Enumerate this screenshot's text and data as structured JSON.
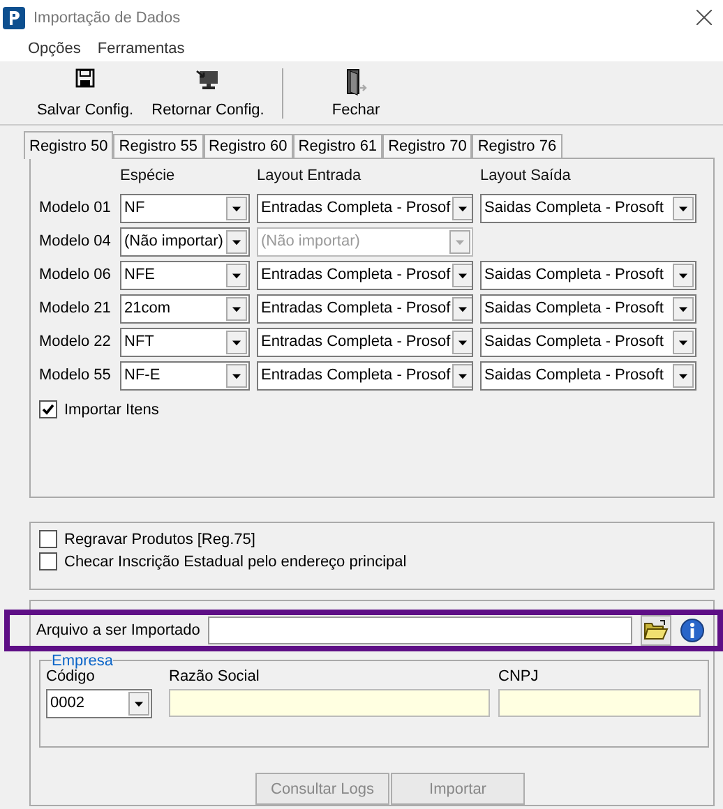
{
  "window": {
    "title": "Importação de Dados"
  },
  "menu": [
    "Opções",
    "Ferramentas"
  ],
  "toolbar": [
    {
      "label": "Salvar Config.",
      "kind": "save"
    },
    {
      "label": "Retornar Config.",
      "kind": "restore"
    },
    {
      "label": "Fechar",
      "kind": "exit"
    }
  ],
  "tabs": [
    {
      "label": "Registro 50",
      "selected": true
    },
    {
      "label": "Registro 55",
      "selected": false
    },
    {
      "label": "Registro 60",
      "selected": false
    },
    {
      "label": "Registro 61",
      "selected": false
    },
    {
      "label": "Registro 70",
      "selected": false
    },
    {
      "label": "Registro 76",
      "selected": false
    }
  ],
  "grid": {
    "headers": [
      "Espécie",
      "Layout Entrada",
      "Layout Saída"
    ],
    "rows": [
      {
        "label": "Modelo 01",
        "especie": "NF",
        "entrada": {
          "value": "Entradas Completa - Prosof",
          "disabled": false
        },
        "saida": "Saidas Completa - Prosoft"
      },
      {
        "label": "Modelo 04",
        "especie": "(Não importar)",
        "entrada": {
          "value": "(Não importar)",
          "disabled": true
        }
      },
      {
        "label": "Modelo 06",
        "especie": "NFE",
        "entrada": {
          "value": "Entradas Completa - Prosof",
          "disabled": false
        },
        "saida": "Saidas Completa - Prosoft"
      },
      {
        "label": "Modelo 21",
        "especie": "21com",
        "entrada": {
          "value": "Entradas Completa - Prosof",
          "disabled": false
        },
        "saida": "Saidas Completa - Prosoft"
      },
      {
        "label": "Modelo 22",
        "especie": "NFT",
        "entrada": {
          "value": "Entradas Completa - Prosof",
          "disabled": false
        },
        "saida": "Saidas Completa - Prosoft"
      },
      {
        "label": "Modelo 55",
        "especie": "NF-E",
        "entrada": {
          "value": "Entradas Completa - Prosof",
          "disabled": false
        },
        "saida": "Saidas Completa - Prosoft"
      }
    ]
  },
  "import_items": {
    "label": "Importar Itens",
    "checked": true
  },
  "options": [
    {
      "label": "Regravar Produtos [Reg.75]",
      "checked": false
    },
    {
      "label": "Checar Inscrição Estadual pelo endereço principal",
      "checked": false
    }
  ],
  "file": {
    "label": "Arquivo a ser Importado",
    "highlighted": true
  },
  "company": {
    "legend": "Empresa",
    "code_label": "Código",
    "code": "0002",
    "name_label": "Razão Social",
    "cnpj_label": "CNPJ"
  },
  "buttons": [
    {
      "label": "Consultar Logs",
      "disabled": true
    },
    {
      "label": "Importar",
      "disabled": true
    }
  ]
}
